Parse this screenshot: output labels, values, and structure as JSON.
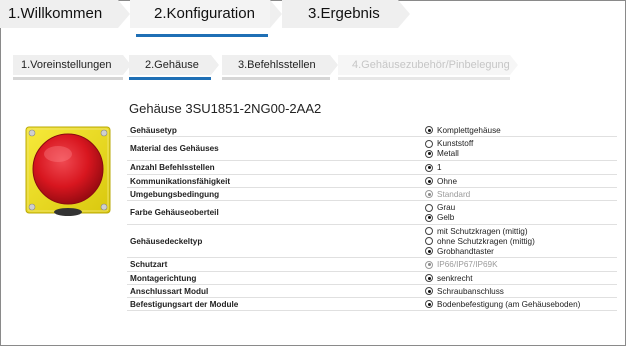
{
  "main_steps": [
    {
      "label": "1.Willkommen",
      "active": false
    },
    {
      "label": "2.Konfiguration",
      "active": true
    },
    {
      "label": "3.Ergebnis",
      "active": false
    }
  ],
  "sub_steps": [
    {
      "label": "1.Voreinstellungen",
      "state": "normal"
    },
    {
      "label": "2.Gehäuse",
      "state": "active"
    },
    {
      "label": "3.Befehlsstellen",
      "state": "normal"
    },
    {
      "label": "4.Gehäusezubehör/Pinbelegung",
      "state": "disabled"
    }
  ],
  "product": {
    "title": "Gehäuse 3SU1851-2NG00-2AA2"
  },
  "properties": [
    {
      "label": "Gehäusetyp",
      "options": [
        {
          "text": "Komplettgehäuse",
          "selected": true
        }
      ]
    },
    {
      "label": "Material des Gehäuses",
      "options": [
        {
          "text": "Kunststoff",
          "selected": false
        },
        {
          "text": "Metall",
          "selected": true
        }
      ]
    },
    {
      "label": "Anzahl Befehlsstellen",
      "options": [
        {
          "text": "1",
          "selected": true
        }
      ]
    },
    {
      "label": "Kommunikationsfähigkeit",
      "options": [
        {
          "text": "Ohne",
          "selected": true
        }
      ]
    },
    {
      "label": "Umgebungsbedingung",
      "options": [
        {
          "text": "Standard",
          "selected": true,
          "disabled": true
        }
      ]
    },
    {
      "label": "Farbe Gehäuseoberteil",
      "options": [
        {
          "text": "Grau",
          "selected": false
        },
        {
          "text": "Gelb",
          "selected": true
        }
      ]
    },
    {
      "label": "Gehäusedeckeltyp",
      "options": [
        {
          "text": "mit Schutzkragen (mittig)",
          "selected": false
        },
        {
          "text": "ohne Schutzkragen (mittig)",
          "selected": false
        },
        {
          "text": "Grobhandtaster",
          "selected": true
        }
      ]
    },
    {
      "label": "Schutzart",
      "options": [
        {
          "text": "IP66/IP67/IP69K",
          "selected": true,
          "disabled": true
        }
      ]
    },
    {
      "label": "Montagerichtung",
      "options": [
        {
          "text": "senkrecht",
          "selected": true
        }
      ]
    },
    {
      "label": "Anschlussart Modul",
      "options": [
        {
          "text": "Schraubanschluss",
          "selected": true
        }
      ]
    },
    {
      "label": "Befestigungsart der Module",
      "options": [
        {
          "text": "Bodenbefestigung (am Gehäuseboden)",
          "selected": true
        }
      ]
    }
  ],
  "colors": {
    "accent": "#1f6fb5",
    "tab_bg": "#efefef",
    "housing_yellow": "#f2e21a",
    "button_red": "#d8161f"
  }
}
